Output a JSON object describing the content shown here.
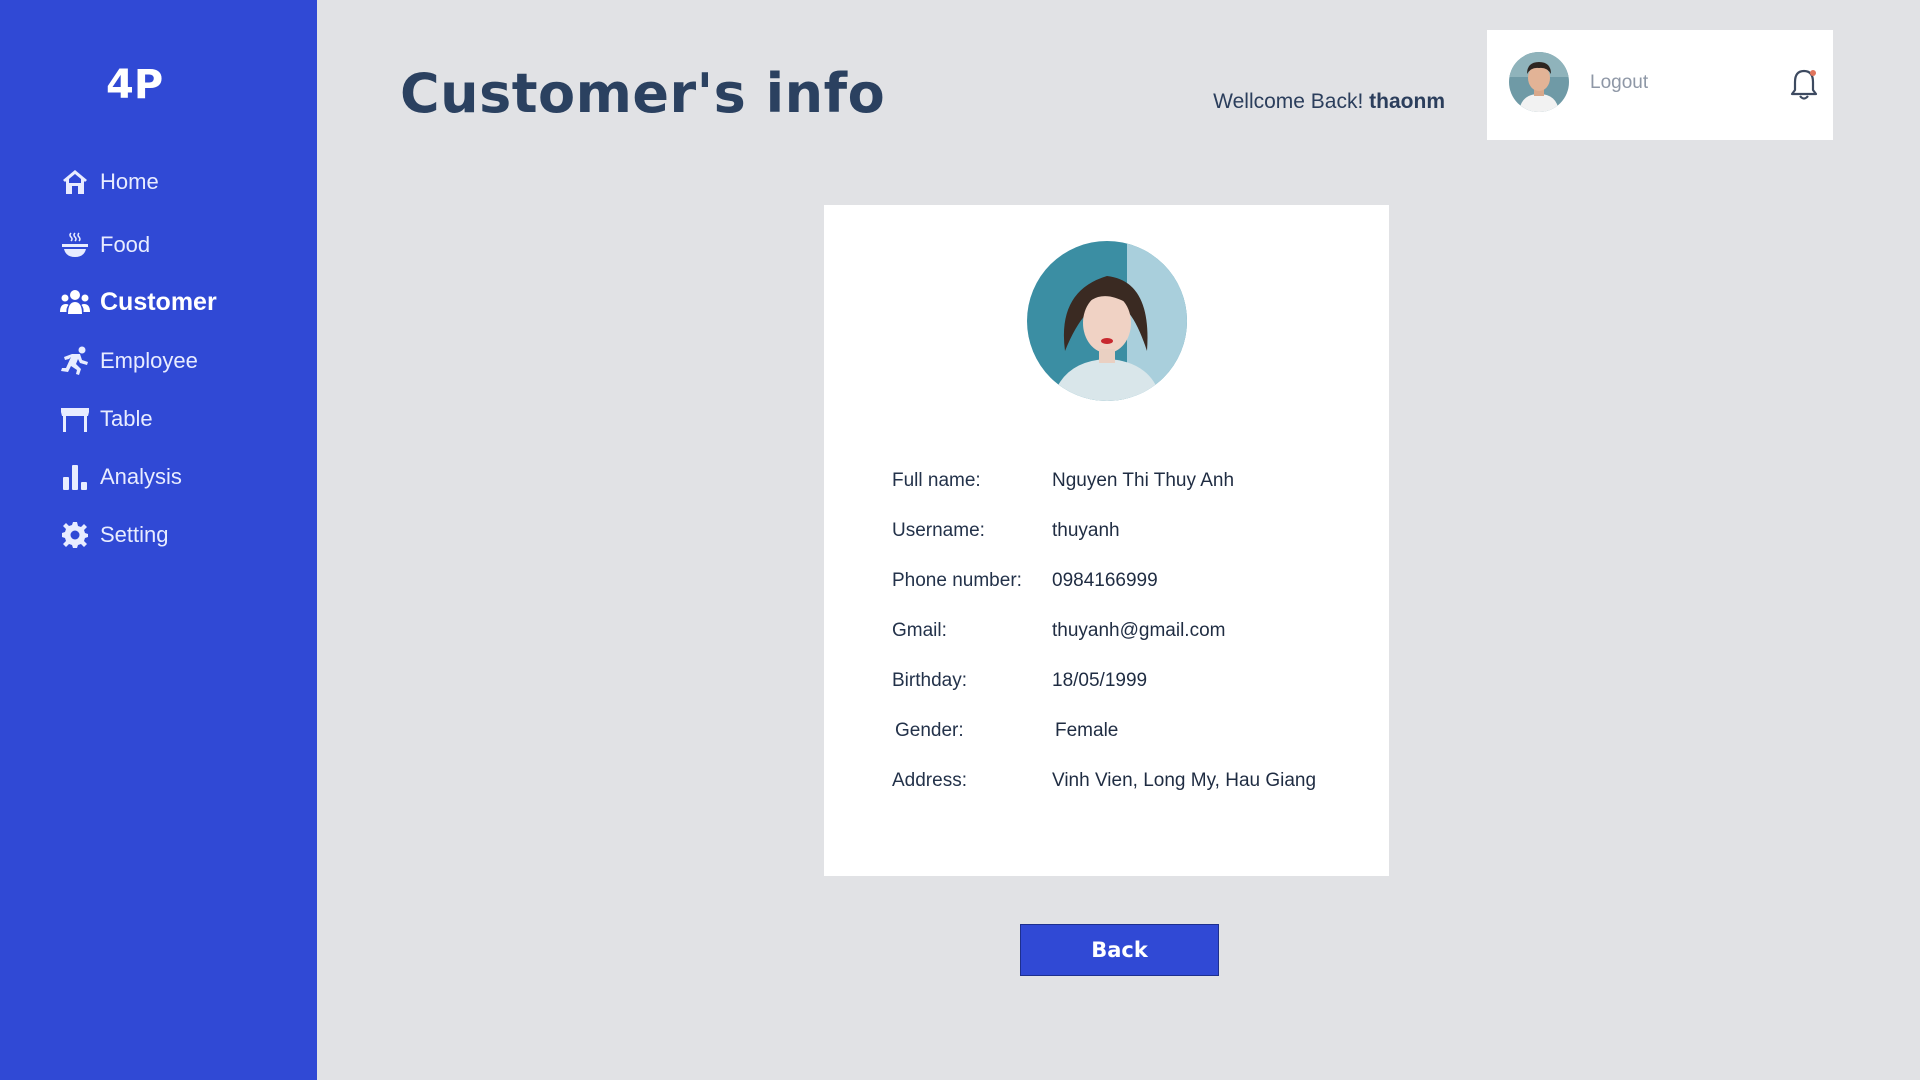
{
  "app": {
    "logo": "4P"
  },
  "sidebar": {
    "items": [
      {
        "label": "Home",
        "icon": "home-icon",
        "active": false
      },
      {
        "label": "Food",
        "icon": "food-bowl-icon",
        "active": false
      },
      {
        "label": "Customer",
        "icon": "users-icon",
        "active": true
      },
      {
        "label": "Employee",
        "icon": "running-person-icon",
        "active": false
      },
      {
        "label": "Table",
        "icon": "table-icon",
        "active": false
      },
      {
        "label": "Analysis",
        "icon": "bar-chart-icon",
        "active": false
      },
      {
        "label": "Setting",
        "icon": "gear-icon",
        "active": false
      }
    ]
  },
  "header": {
    "title": "Customer's info",
    "welcome_prefix": "Wellcome Back!",
    "username": "thaonm",
    "logout_label": "Logout"
  },
  "customer": {
    "fields": [
      {
        "label": "Full name:",
        "value": "Nguyen Thi Thuy Anh"
      },
      {
        "label": "Username:",
        "value": "thuyanh"
      },
      {
        "label": "Phone number:",
        "value": "0984166999"
      },
      {
        "label": "Gmail:",
        "value": "thuyanh@gmail.com"
      },
      {
        "label": "Birthday:",
        "value": "18/05/1999"
      },
      {
        "label": "Gender:",
        "value": "Female"
      },
      {
        "label": "Address:",
        "value": "Vinh Vien, Long My, Hau Giang"
      }
    ]
  },
  "actions": {
    "back_label": "Back"
  },
  "colors": {
    "sidebar": "#3049d5",
    "background": "#e1e2e5",
    "title": "#2b4160",
    "notification_dot": "#e0745c"
  }
}
